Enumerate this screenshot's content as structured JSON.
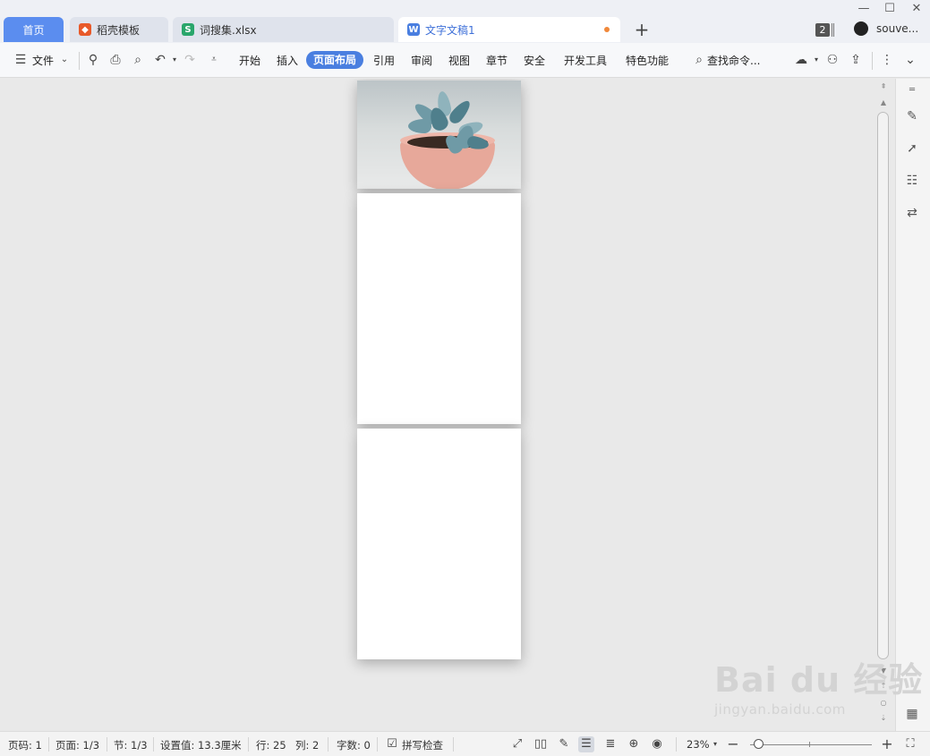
{
  "window": {
    "minimize": "—",
    "maximize": "☐",
    "close": "✕"
  },
  "tabs": [
    {
      "label": "首页"
    },
    {
      "label": "稻壳模板",
      "icon": "daoke-icon"
    },
    {
      "label": "词搜集.xlsx",
      "icon": "spreadsheet-icon"
    },
    {
      "label": "文字文稿1",
      "icon": "writer-icon"
    }
  ],
  "tabbar": {
    "new_tab": "+",
    "window_count": "2",
    "user_name": "souve..."
  },
  "toolbar": {
    "file_label": "文件",
    "menus": [
      "开始",
      "插入",
      "页面布局",
      "引用",
      "审阅",
      "视图",
      "章节",
      "安全",
      "开发工具",
      "特色功能"
    ],
    "active_menu": "页面布局",
    "search_label": "查找命令..."
  },
  "document": {
    "pages": 3,
    "image_on_page": 1,
    "image_subject": "succulent in pink pot"
  },
  "watermark": {
    "main": "Bai du 经验",
    "sub": "jingyan.baidu.com"
  },
  "status": {
    "page_no": "页码: 1",
    "pages": "页面: 1/3",
    "section": "节: 1/3",
    "setting": "设置值: 13.3厘米",
    "row": "行: 25",
    "col": "列: 2",
    "words": "字数: 0",
    "spell": "拼写检查",
    "zoom": "23%",
    "zoom_percent": 23
  },
  "colors": {
    "accent": "#4a7fe0",
    "home_tab": "#5b8def",
    "unsaved_dot": "#f0883a"
  }
}
